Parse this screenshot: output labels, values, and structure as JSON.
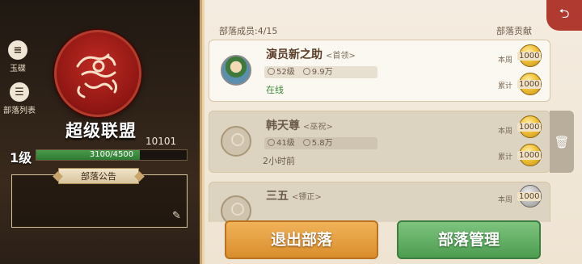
{
  "sidebar": {
    "items": [
      {
        "label": "玉碟",
        "icon": "scroll-list-icon"
      },
      {
        "label": "部落列表",
        "icon": "menu-list-icon"
      }
    ]
  },
  "alliance": {
    "name": "超级联盟",
    "points": "10101",
    "level": "1级",
    "exp": "3100/4500",
    "exp_fraction": 0.689,
    "notice_title": "部落公告",
    "notice_text": "",
    "emblem": "tiger-emblem"
  },
  "list": {
    "members_label": "部落成员:4/15",
    "contrib_label": "部落贡献",
    "members": [
      {
        "name": "演员新之助",
        "role": "<首领>",
        "level": "52级",
        "power": "9.9万",
        "status": "在线",
        "online": true,
        "weekly_label": "本周",
        "weekly": "1000",
        "total_label": "累计",
        "total": "1000"
      },
      {
        "name": "韩天尊",
        "role": "<巫祝>",
        "level": "41级",
        "power": "5.8万",
        "status": "2小时前",
        "online": false,
        "weekly_label": "本周",
        "weekly": "1000",
        "total_label": "累计",
        "total": "1000"
      },
      {
        "name": "三五",
        "role": "<镖正>",
        "weekly_label": "本周",
        "weekly": "1000"
      }
    ]
  },
  "buttons": {
    "quit": "退出部落",
    "manage": "部落管理"
  },
  "colors": {
    "online": "#3a8a3a",
    "quit_button": "#e09a38",
    "manage_button": "#5fae62",
    "emblem": "#a81e1a"
  }
}
